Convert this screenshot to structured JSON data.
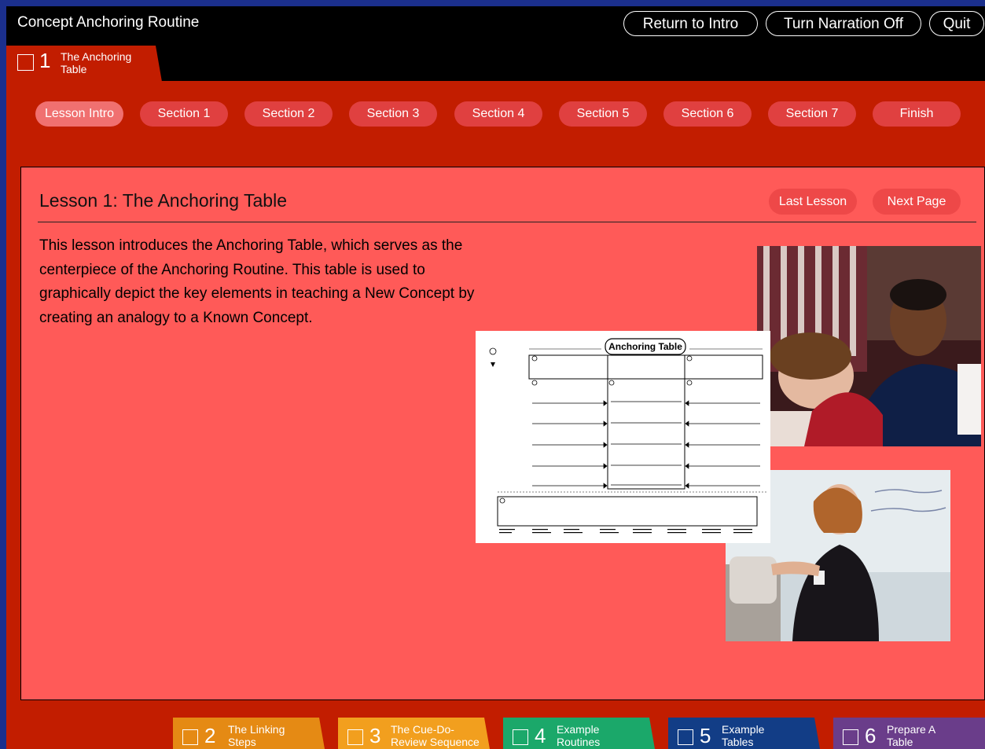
{
  "app": {
    "title": "Concept Anchoring Routine"
  },
  "header_buttons": {
    "return": "Return to Intro",
    "narration": "Turn Narration Off",
    "quit": "Quit"
  },
  "current_module": {
    "number": "1",
    "label_line1": "The Anchoring",
    "label_line2": "Table"
  },
  "sections": [
    "Lesson Intro",
    "Section 1",
    "Section 2",
    "Section 3",
    "Section 4",
    "Section 5",
    "Section 6",
    "Section 7",
    "Finish"
  ],
  "lesson": {
    "title": "Lesson 1: The Anchoring Table",
    "last_label": "Last Lesson",
    "next_label": "Next Page",
    "text": "This lesson introduces the Anchoring Table, which serves as the centerpiece of the Anchoring Routine. This table is used to graphically depict the key elements in teaching a New Concept by creating an analogy to a Known Concept."
  },
  "worksheet": {
    "title": "Anchoring Table"
  },
  "modules": [
    {
      "number": "2",
      "line1": "The Linking",
      "line2": "Steps",
      "color": "#e58a14"
    },
    {
      "number": "3",
      "line1": "The Cue-Do-",
      "line2": "Review Sequence",
      "color": "#f29f1e"
    },
    {
      "number": "4",
      "line1": "Example",
      "line2": "Routines",
      "color": "#1ba86a"
    },
    {
      "number": "5",
      "line1": "Example",
      "line2": "Tables",
      "color": "#123d86"
    },
    {
      "number": "6",
      "line1": "Prepare A",
      "line2": "Table",
      "color": "#6a3d8a"
    }
  ]
}
